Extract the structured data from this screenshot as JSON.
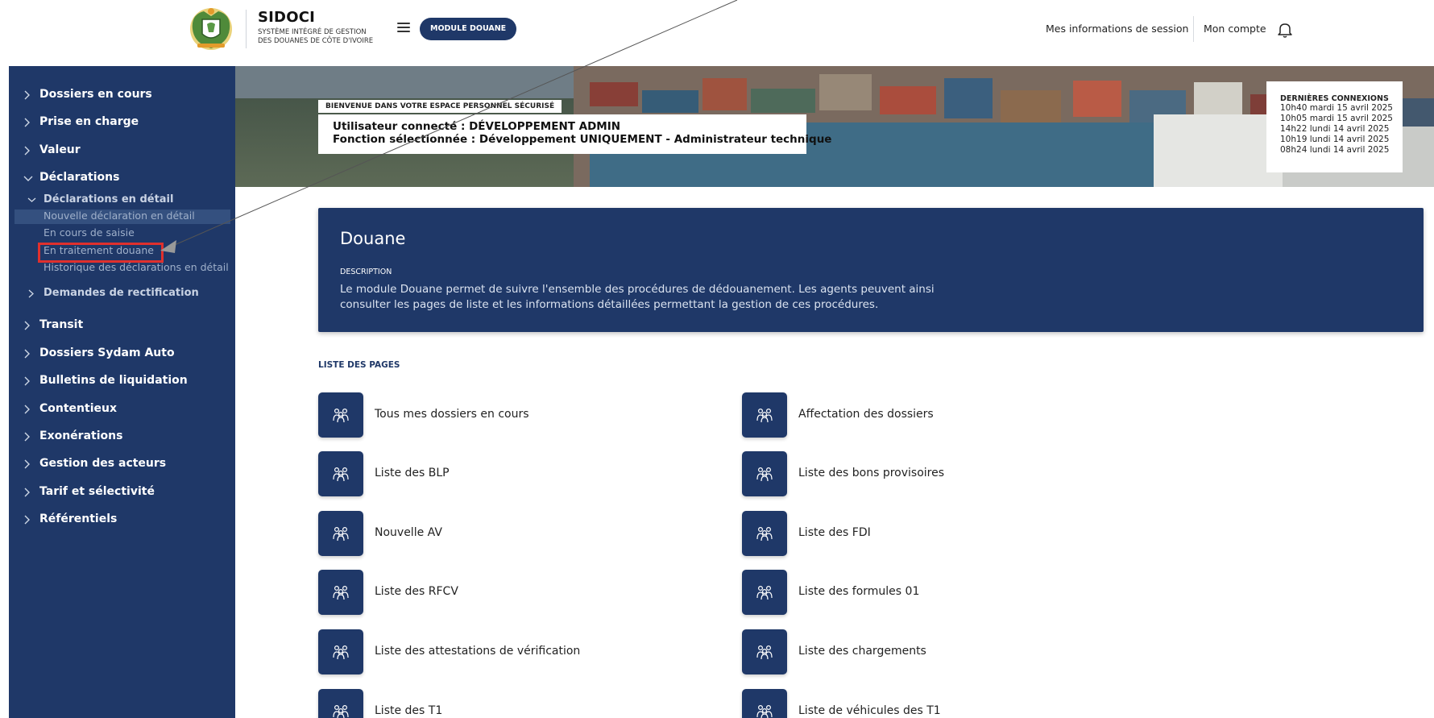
{
  "header": {
    "brand_name": "SIDOCI",
    "brand_sub_1": "SYSTÈME INTÉGRÉ DE GESTION",
    "brand_sub_2": "DES DOUANES DE CÔTE D'IVOIRE",
    "module_label": "MODULE DOUANE",
    "session_label": "Mes informations de session",
    "account_label": "Mon compte"
  },
  "sidebar": {
    "items": [
      {
        "label": "Dossiers en cours"
      },
      {
        "label": "Prise en charge"
      },
      {
        "label": "Valeur"
      },
      {
        "label": "Déclarations"
      },
      {
        "label": "Transit"
      },
      {
        "label": "Dossiers Sydam Auto"
      },
      {
        "label": "Bulletins de liquidation"
      },
      {
        "label": "Contentieux"
      },
      {
        "label": "Exonérations"
      },
      {
        "label": "Gestion des acteurs"
      },
      {
        "label": "Tarif et sélectivité"
      },
      {
        "label": "Référentiels"
      }
    ],
    "declarations": {
      "sub_open": "Déclarations en détail",
      "leaves": [
        "Nouvelle déclaration en détail",
        "En cours de saisie",
        "En traitement douane",
        "Historique des déclarations en détail"
      ],
      "sub_closed": "Demandes de rectification"
    }
  },
  "banner": {
    "welcome_tag": "BIENVENUE DANS VOTRE ESPACE PERSONNEL SÉCURISÉ",
    "user_line": "Utilisateur connecté : DÉVELOPPEMENT ADMIN",
    "function_line": "Fonction sélectionnée : Développement UNIQUEMENT - Administrateur technique",
    "connections_title": "DERNIÈRES CONNEXIONS",
    "connections": [
      "10h40 mardi 15 avril 2025",
      "10h05 mardi 15 avril 2025",
      "14h22 lundi 14 avril 2025",
      "10h19 lundi 14 avril 2025",
      "08h24 lundi 14 avril 2025"
    ]
  },
  "douane": {
    "title": "Douane",
    "desc_label": "DESCRIPTION",
    "description": "Le module Douane permet de suivre l'ensemble des procédures de dédouanement. Les agents peuvent ainsi consulter les pages de liste et les informations détaillées permettant la gestion de ces procédures."
  },
  "pages": {
    "title": "LISTE DES PAGES",
    "left": [
      "Tous mes dossiers en cours",
      "Liste des BLP",
      "Nouvelle AV",
      "Liste des RFCV",
      "Liste des attestations de vérification",
      "Liste des T1"
    ],
    "right": [
      "Affectation des dossiers",
      "Liste des bons provisoires",
      "Liste des FDI",
      "Liste des formules 01",
      "Liste des chargements",
      "Liste de véhicules des T1"
    ]
  },
  "colors": {
    "navy": "#1f3868",
    "highlight_red": "#e0302d"
  }
}
